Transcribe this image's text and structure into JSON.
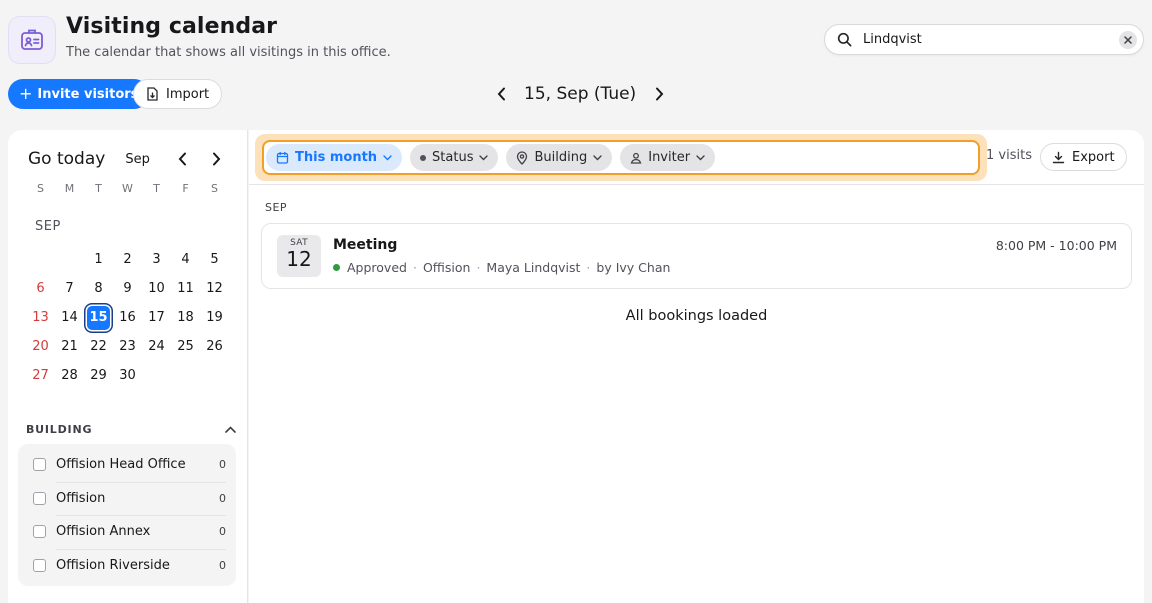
{
  "header": {
    "title": "Visiting calendar",
    "subtitle": "The calendar that shows all visitings in this office.",
    "app_icon": "visitor-badge-icon",
    "accent": "#7c5cd6"
  },
  "search": {
    "value": "Lindqvist",
    "placeholder": "Search",
    "icon": "search-icon"
  },
  "toolbar": {
    "invite_label": "Invite visitors",
    "import_label": "Import",
    "primary_color": "#1677ff"
  },
  "date_nav": {
    "label": "15, Sep (Tue)"
  },
  "mini_calendar": {
    "go_today": "Go today",
    "month_label": "Sep",
    "month_upper": "SEP",
    "weekdays": [
      "S",
      "M",
      "T",
      "W",
      "T",
      "F",
      "S"
    ],
    "weeks": [
      [
        "",
        "",
        "1",
        "2",
        "3",
        "4",
        "5"
      ],
      [
        "6",
        "7",
        "8",
        "9",
        "10",
        "11",
        "12"
      ],
      [
        "13",
        "14",
        "15",
        "16",
        "17",
        "18",
        "19"
      ],
      [
        "20",
        "21",
        "22",
        "23",
        "24",
        "25",
        "26"
      ],
      [
        "27",
        "28",
        "29",
        "30",
        "",
        "",
        ""
      ]
    ],
    "selected_day": "15"
  },
  "building_filter": {
    "title": "BUILDING",
    "items": [
      {
        "label": "Offision Head Office",
        "count": "0"
      },
      {
        "label": "Offision",
        "count": "0"
      },
      {
        "label": "Offision Annex",
        "count": "0"
      },
      {
        "label": "Offision Riverside",
        "count": "0"
      }
    ]
  },
  "filters": {
    "range_label": "This month",
    "status_label": "Status",
    "building_label": "Building",
    "inviter_label": "Inviter",
    "highlight_color": "#f0a028"
  },
  "results": {
    "count_label": "1 visits",
    "export_label": "Export",
    "section_label": "SEP",
    "loaded_label": "All bookings loaded"
  },
  "events": [
    {
      "dow": "SAT",
      "day": "12",
      "title": "Meeting",
      "status": "Approved",
      "building": "Offision",
      "visitor": "Maya Lindqvist",
      "inviter": "by Ivy Chan",
      "time": "8:00 PM - 10:00 PM",
      "status_color": "#2e9b3e"
    }
  ]
}
